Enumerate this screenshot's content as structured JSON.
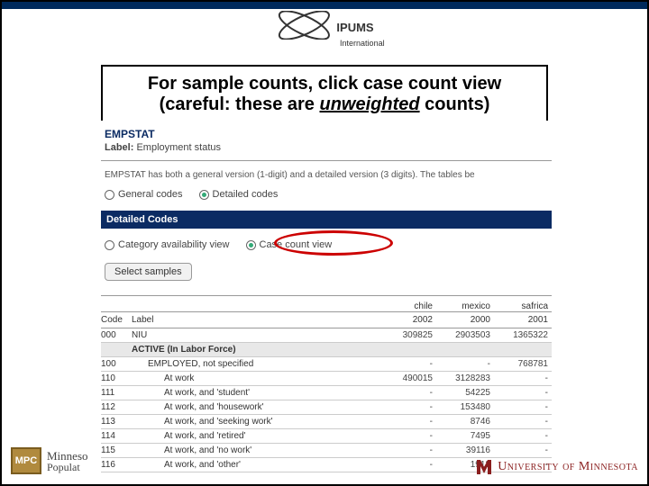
{
  "branding": {
    "ipums_name": "IPUMS",
    "ipums_sub": "International",
    "mpc_badge": "MPC",
    "mpc_line1": "Minneso",
    "mpc_line2": "Populat",
    "um": "University of Minnesota"
  },
  "title": {
    "line1": "For sample counts, click case count view",
    "line2_a": "(careful:  these are ",
    "line2_u": "unweighted",
    "line2_b": " counts)"
  },
  "variable": {
    "name": "EMPSTAT",
    "label_prefix": "Label:",
    "label_value": "Employment status",
    "description": "EMPSTAT has both a general version (1-digit) and a detailed version (3 digits). The tables be"
  },
  "code_level": {
    "general": "General codes",
    "detailed": "Detailed codes",
    "detailed_selected": true
  },
  "section_band": "Detailed Codes",
  "view": {
    "availability": "Category availability view",
    "casecount": "Case count view",
    "casecount_selected": true
  },
  "select_button": "Select samples",
  "columns": {
    "code": "Code",
    "label": "Label",
    "samples": [
      {
        "country": "chile",
        "year": "2002"
      },
      {
        "country": "mexico",
        "year": "2000"
      },
      {
        "country": "safrica",
        "year": "2001"
      }
    ]
  },
  "rows": [
    {
      "code": "000",
      "label": "NIU",
      "indent": 0,
      "section": false,
      "vals": [
        "309825",
        "2903503",
        "1365322"
      ]
    },
    {
      "code": "",
      "label": "ACTIVE (In Labor Force)",
      "indent": 0,
      "section": true,
      "vals": [
        "",
        "",
        ""
      ]
    },
    {
      "code": "100",
      "label": "EMPLOYED, not specified",
      "indent": 1,
      "section": false,
      "vals": [
        "-",
        "-",
        "768781"
      ]
    },
    {
      "code": "110",
      "label": "At work",
      "indent": 2,
      "section": false,
      "vals": [
        "490015",
        "3128283",
        "-"
      ]
    },
    {
      "code": "111",
      "label": "At work, and 'student'",
      "indent": 2,
      "section": false,
      "vals": [
        "-",
        "54225",
        "-"
      ]
    },
    {
      "code": "112",
      "label": "At work, and 'housework'",
      "indent": 2,
      "section": false,
      "vals": [
        "-",
        "153480",
        "-"
      ]
    },
    {
      "code": "113",
      "label": "At work, and 'seeking work'",
      "indent": 2,
      "section": false,
      "vals": [
        "-",
        "8746",
        "-"
      ]
    },
    {
      "code": "114",
      "label": "At work, and 'retired'",
      "indent": 2,
      "section": false,
      "vals": [
        "-",
        "7495",
        "-"
      ]
    },
    {
      "code": "115",
      "label": "At work, and 'no work'",
      "indent": 2,
      "section": false,
      "vals": [
        "-",
        "39116",
        "-"
      ]
    },
    {
      "code": "116",
      "label": "At work, and 'other'",
      "indent": 2,
      "section": false,
      "vals": [
        "-",
        "1912",
        "-"
      ]
    }
  ]
}
